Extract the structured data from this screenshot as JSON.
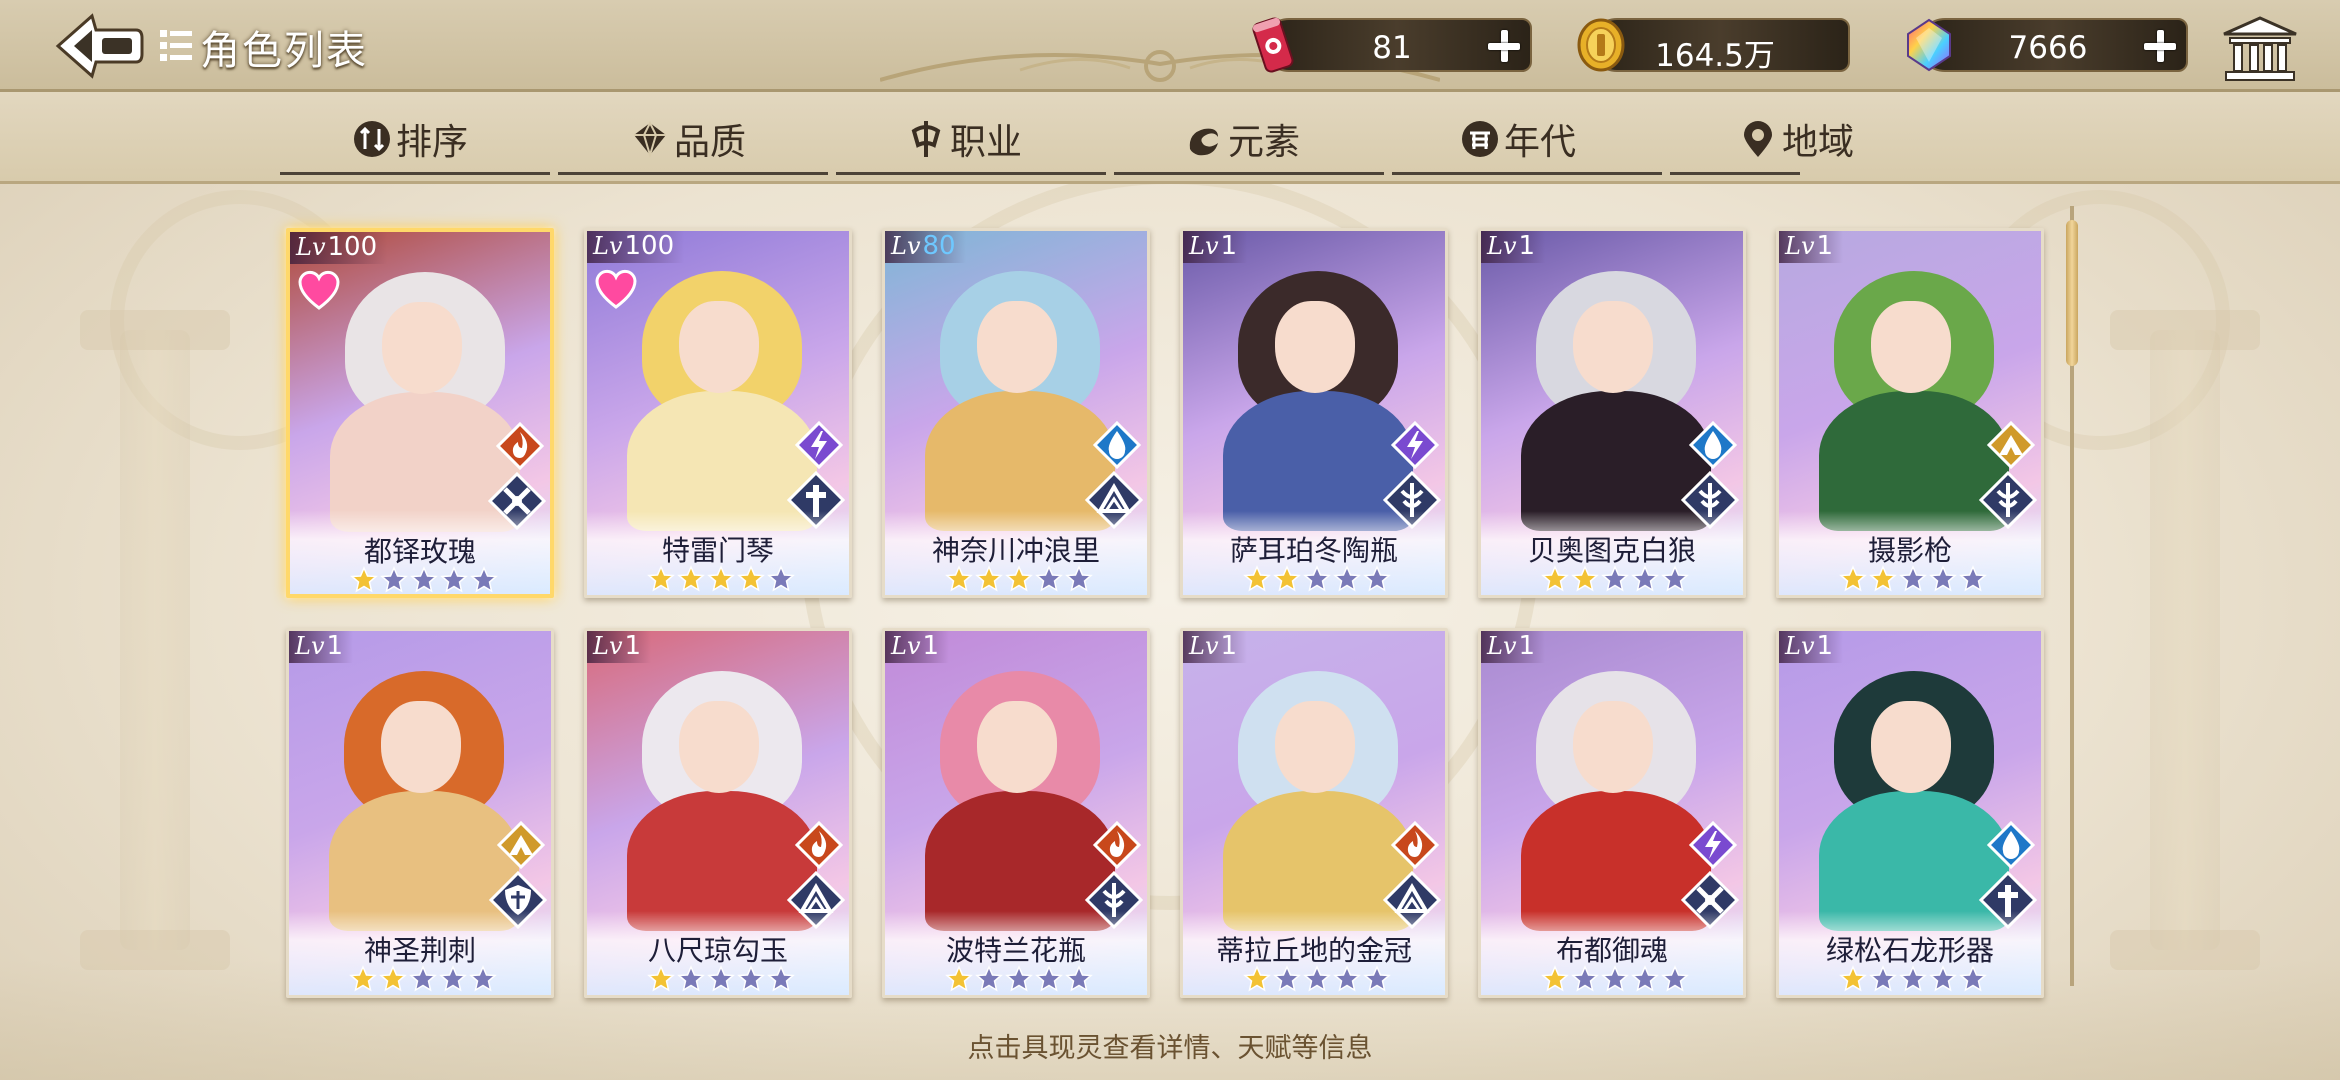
{
  "header": {
    "title": "角色列表",
    "back_icon": "back-arrow-icon",
    "list_icon": "list-icon"
  },
  "currencies": [
    {
      "name": "stamina",
      "icon": "energy-can-icon",
      "value": "81"
    },
    {
      "name": "gold",
      "icon": "gold-coin-icon",
      "value": "164.5万"
    },
    {
      "name": "gem",
      "icon": "rainbow-gem-icon",
      "value": "7666"
    }
  ],
  "tabs": [
    {
      "label": "排序",
      "icon": "sort-icon"
    },
    {
      "label": "品质",
      "icon": "quality-icon"
    },
    {
      "label": "职业",
      "icon": "class-icon"
    },
    {
      "label": "元素",
      "icon": "element-icon"
    },
    {
      "label": "年代",
      "icon": "era-icon"
    },
    {
      "label": "地域",
      "icon": "location-pin-icon"
    }
  ],
  "cards": [
    {
      "name": "都铎玫瑰",
      "lv_prefix": "Lv",
      "lv": "100",
      "stars": 1,
      "element": "fire",
      "role": "cross-sword",
      "heart": true,
      "selected": true,
      "palette": [
        "#b04a3a",
        "#e9e4e6",
        "#f2d2c8"
      ]
    },
    {
      "name": "特雷门琴",
      "lv_prefix": "Lv",
      "lv": "100",
      "stars": 4,
      "element": "thunder",
      "role": "cross",
      "heart": true,
      "selected": false,
      "palette": [
        "#8f7ad8",
        "#f2d26a",
        "#f5e6b4"
      ]
    },
    {
      "name": "神奈川冲浪里",
      "lv_prefix": "Lv",
      "lv": "80",
      "stars": 3,
      "element": "water",
      "role": "book",
      "heart": false,
      "selected": false,
      "palette": [
        "#7fb6d6",
        "#a7d0e6",
        "#e6b96a"
      ]
    },
    {
      "name": "萨耳珀冬陶瓶",
      "lv_prefix": "Lv",
      "lv": "1",
      "stars": 2,
      "element": "thunder",
      "role": "spear",
      "heart": false,
      "selected": false,
      "palette": [
        "#6a5aa8",
        "#3b2a2a",
        "#4a5fa8"
      ]
    },
    {
      "name": "贝奥图克白狼",
      "lv_prefix": "Lv",
      "lv": "1",
      "stars": 2,
      "element": "water",
      "role": "spear",
      "heart": false,
      "selected": false,
      "palette": [
        "#6a5aa8",
        "#d8d8e0",
        "#2a1e28"
      ]
    },
    {
      "name": "摄影枪",
      "lv_prefix": "Lv",
      "lv": "1",
      "stars": 2,
      "element": "earth",
      "role": "spear",
      "heart": false,
      "selected": false,
      "palette": [
        "#b7a9e0",
        "#6aa84a",
        "#2f6a3a"
      ]
    },
    {
      "name": "神圣荆刺",
      "lv_prefix": "Lv",
      "lv": "1",
      "stars": 2,
      "element": "earth",
      "role": "shield",
      "heart": false,
      "selected": false,
      "palette": [
        "#b59ae8",
        "#d86a2a",
        "#e8c080"
      ]
    },
    {
      "name": "八尺琼勾玉",
      "lv_prefix": "Lv",
      "lv": "1",
      "stars": 1,
      "element": "fire",
      "role": "book",
      "heart": false,
      "selected": false,
      "palette": [
        "#d86a7a",
        "#ece8ee",
        "#c83a3a"
      ]
    },
    {
      "name": "波特兰花瓶",
      "lv_prefix": "Lv",
      "lv": "1",
      "stars": 1,
      "element": "fire",
      "role": "spear",
      "heart": false,
      "selected": false,
      "palette": [
        "#c08ad8",
        "#e88aa8",
        "#a8282a"
      ]
    },
    {
      "name": "蒂拉丘地的金冠",
      "lv_prefix": "Lv",
      "lv": "1",
      "stars": 1,
      "element": "fire",
      "role": "book",
      "heart": false,
      "selected": false,
      "palette": [
        "#c6b2ea",
        "#cfe0f0",
        "#e6c46a"
      ]
    },
    {
      "name": "布都御魂",
      "lv_prefix": "Lv",
      "lv": "1",
      "stars": 1,
      "element": "thunder",
      "role": "cross-sword",
      "heart": false,
      "selected": false,
      "palette": [
        "#a88ad0",
        "#e6e2e8",
        "#c8302a"
      ]
    },
    {
      "name": "绿松石龙形器",
      "lv_prefix": "Lv",
      "lv": "1",
      "stars": 1,
      "element": "water",
      "role": "cross",
      "heart": false,
      "selected": false,
      "palette": [
        "#b59ae8",
        "#1e3a3a",
        "#3ab8a8"
      ]
    }
  ],
  "max_stars": 5,
  "footer": {
    "tip": "点击具现灵查看详情、天赋等信息"
  },
  "colors": {
    "fire": "#c8481c",
    "water": "#1e78c8",
    "thunder": "#7a4ad0",
    "earth": "#d09a2a",
    "role_badge": "#2f3a66",
    "star_on": "#f3c234",
    "star_off": "#7a7ab8"
  }
}
